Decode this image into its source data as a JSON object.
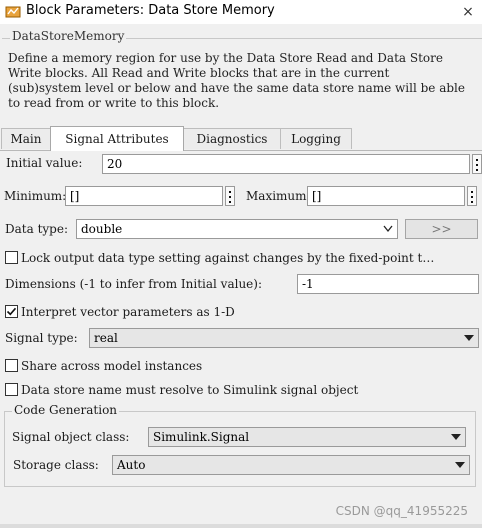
{
  "window": {
    "title": "Block Parameters: Data Store Memory",
    "close_glyph": "×"
  },
  "description": {
    "legend": "DataStoreMemory",
    "lines": [
      "Define a memory region for use by the Data Store Read and Data Store",
      "Write blocks. All Read and Write blocks that are in the current",
      "(sub)system level or below and have the same data store name will be able",
      "to read from or write to this block."
    ]
  },
  "tabs": [
    {
      "label": "Main"
    },
    {
      "label": "Signal Attributes",
      "active": true
    },
    {
      "label": "Diagnostics"
    },
    {
      "label": "Logging"
    }
  ],
  "initial_value": {
    "label": "Initial value:",
    "value": "20"
  },
  "minimum": {
    "label": "Minimum:",
    "value": "[]"
  },
  "maximum": {
    "label": "Maximum:",
    "value": "[]"
  },
  "data_type": {
    "label": "Data type:",
    "value": "double",
    "assistant_button": ">>"
  },
  "lock_output": {
    "label": "Lock output data type setting against changes by the fixed-point t…",
    "checked": false
  },
  "dimensions": {
    "label": "Dimensions (-1 to infer from Initial value):",
    "value": "-1"
  },
  "interpret_vector": {
    "label": "Interpret vector parameters as 1-D",
    "checked": true
  },
  "signal_type": {
    "label": "Signal type:",
    "value": "real"
  },
  "share_instances": {
    "label": "Share across model instances",
    "checked": false
  },
  "resolve_simulink": {
    "label": "Data store name must resolve to Simulink signal object",
    "checked": false
  },
  "code_generation": {
    "legend": "Code Generation",
    "signal_object_class": {
      "label": "Signal object class:",
      "value": "Simulink.Signal"
    },
    "storage_class": {
      "label": "Storage class:",
      "value": "Auto"
    }
  },
  "watermark": "CSDN @qq_41955225",
  "icons": {
    "app": "simulink-block-icon",
    "checked": "checkmark-icon"
  },
  "colors": {
    "accent": "#1565c0",
    "background": "#f0f0f0",
    "panel": "#ffffff"
  }
}
